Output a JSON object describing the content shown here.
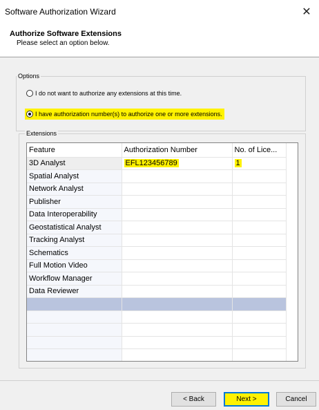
{
  "window": {
    "title": "Software Authorization Wizard",
    "close_glyph": "✕"
  },
  "header": {
    "title": "Authorize Software Extensions",
    "subtitle": "Please select an option below."
  },
  "options": {
    "label": "Options",
    "radio1": "I do not want to authorize any extensions at this time.",
    "radio2": "I have authorization number(s) to authorize one or more extensions.",
    "selected": "radio2"
  },
  "extensions": {
    "label": "Extensions",
    "columns": [
      "Feature",
      "Authorization Number",
      "No. of Lice..."
    ],
    "rows": [
      {
        "feature": "3D Analyst",
        "auth": "EFL123456789",
        "count": "1"
      },
      {
        "feature": "Spatial Analyst",
        "auth": "",
        "count": ""
      },
      {
        "feature": "Network Analyst",
        "auth": "",
        "count": ""
      },
      {
        "feature": "Publisher",
        "auth": "",
        "count": ""
      },
      {
        "feature": "Data Interoperability",
        "auth": "",
        "count": ""
      },
      {
        "feature": "Geostatistical Analyst",
        "auth": "",
        "count": ""
      },
      {
        "feature": "Tracking Analyst",
        "auth": "",
        "count": ""
      },
      {
        "feature": "Schematics",
        "auth": "",
        "count": ""
      },
      {
        "feature": "Full Motion Video",
        "auth": "",
        "count": ""
      },
      {
        "feature": "Workflow Manager",
        "auth": "",
        "count": ""
      },
      {
        "feature": "Data Reviewer",
        "auth": "",
        "count": ""
      }
    ]
  },
  "buttons": {
    "back": "< Back",
    "next": "Next >",
    "cancel": "Cancel"
  },
  "colors": {
    "highlight": "#fff200",
    "selected_row": "#b9c4de",
    "focus_border": "#0078d7"
  }
}
